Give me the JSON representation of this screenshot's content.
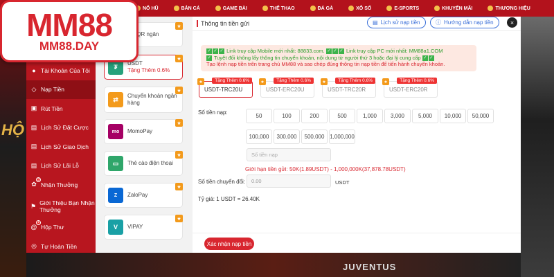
{
  "logo": {
    "main": "MM88",
    "sub": "MM88.DAY"
  },
  "topnav": [
    "NỔ HŨ",
    "BẮN CÁ",
    "GAME BÀI",
    "THỂ THAO",
    "ĐÁ GÀ",
    "XỔ SỐ",
    "E-SPORTS",
    "KHUYẾN MÃI",
    "THƯƠNG HIỆU"
  ],
  "background": {
    "left_text": "HỘ",
    "bottom_text": "JUVENTUS"
  },
  "menu": [
    {
      "label": "Tài Khoản Của Tôi",
      "icon": "user-icon"
    },
    {
      "label": "Nạp Tiền",
      "icon": "deposit-icon",
      "active": true
    },
    {
      "label": "Rút Tiền",
      "icon": "withdraw-icon"
    },
    {
      "label": "Lịch Sử Đặt Cược",
      "icon": "bet-history-icon"
    },
    {
      "label": "Lịch Sử Giao Dịch",
      "icon": "transaction-history-icon"
    },
    {
      "label": "Lịch Sử Lãi Lỗ",
      "icon": "profit-loss-icon"
    },
    {
      "label": "Nhận Thưởng",
      "icon": "gift-icon",
      "badge": "3"
    },
    {
      "label": "Giới Thiệu Bạn Nhận Thưởng",
      "icon": "referral-icon"
    },
    {
      "label": "Hộp Thư",
      "icon": "mail-icon",
      "badge": "1"
    },
    {
      "label": "Tự Hoàn Tiền",
      "icon": "refund-icon"
    }
  ],
  "methods": [
    {
      "label": "mã QR ngân",
      "sub": "",
      "icon": "qr-bank-icon",
      "color": "#3a6fd8"
    },
    {
      "label": "USDT",
      "sub": "Tặng Thêm 0.6%",
      "icon": "tether-icon",
      "color": "#26a17b",
      "active": true
    },
    {
      "label": "Chuyển khoản ngân hàng",
      "sub": "",
      "icon": "bank-transfer-icon",
      "color": "#f39a1b"
    },
    {
      "label": "MomoPay",
      "sub": "",
      "icon": "momo-icon",
      "color": "#a50064"
    },
    {
      "label": "Thẻ cào điện thoại",
      "sub": "",
      "icon": "phone-card-icon",
      "color": "#2fa66a"
    },
    {
      "label": "ZaloPay",
      "sub": "",
      "icon": "zalopay-icon",
      "color": "#0a68d4"
    },
    {
      "label": "VIPAY",
      "sub": "",
      "icon": "vipay-icon",
      "color": "#19a0a5"
    }
  ],
  "panel": {
    "title": "Thông tin tiền gửi",
    "history_button": "Lịch sử nạp tiền",
    "guide_button": "Hướng dẫn nạp tiền",
    "close": "×"
  },
  "notice": {
    "line1_a": "Link truy cập Mobile mới nhất: 88833.com.",
    "line1_b": "Link truy cập PC mới nhất: MM88a1.COM",
    "line2": "Tuyệt đối không lấy thông tin chuyển khoản, nội dung từ người thứ 3 hoặc đại lý cung cấp",
    "line3": "Tạo lệnh nạp tiền trên trang chủ MM88 và sao chép đúng thông tin nạp tiền để tiến hành chuyển khoản."
  },
  "networks": [
    {
      "label": "USDT-TRC20U",
      "tag": "Tặng Thêm 0.6%",
      "active": true
    },
    {
      "label": "USDT-ERC20U",
      "tag": "Tặng Thêm 0.6%"
    },
    {
      "label": "USDT-TRC20R",
      "tag": "Tặng Thêm 0.6%"
    },
    {
      "label": "USDT-ERC20R",
      "tag": "Tặng Thêm 0.6%"
    }
  ],
  "form": {
    "amount_label": "Số tiền nạp:",
    "amounts": [
      "50",
      "100",
      "200",
      "500",
      "1,000",
      "3,000",
      "5,000",
      "10,000",
      "50,000",
      "100,000",
      "300,000",
      "500,000",
      "1,000,000"
    ],
    "amount_placeholder": "Số tiền nạp",
    "limit_text": "Giới hạn tiền gửi:  50K(1.89USDT) - 1,000,000K(37,878.78USDT)",
    "convert_label": "Số tiền chuyển đổi:",
    "convert_value": "0.00",
    "convert_unit": "USDT",
    "rate_text": "Tỷ giá:  1  USDT = 26.40K",
    "submit": "Xác nhận nạp tiền"
  }
}
